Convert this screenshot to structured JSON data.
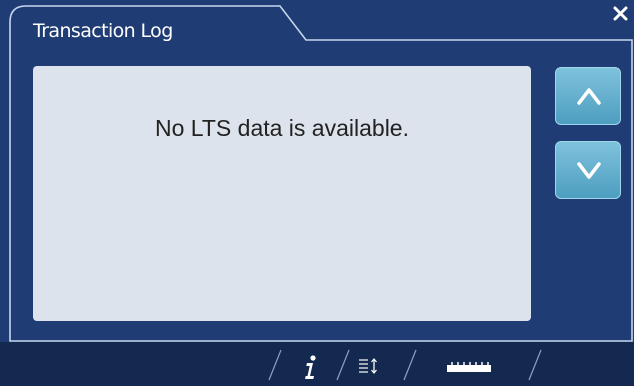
{
  "window": {
    "title": "Transaction Log"
  },
  "content": {
    "message": "No LTS data is available."
  },
  "controls": {
    "close_icon": "close-icon",
    "scroll_up_icon": "chevron-up-icon",
    "scroll_down_icon": "chevron-down-icon"
  },
  "toolbar": {
    "items": [
      {
        "icon": "info-icon"
      },
      {
        "icon": "sort-list-icon"
      },
      {
        "icon": "ruler-icon"
      }
    ]
  },
  "colors": {
    "background": "#1f3d74",
    "panel": "#dde3ec",
    "accent_button": "#5aa8c8",
    "bottom_bar": "#13294f"
  }
}
